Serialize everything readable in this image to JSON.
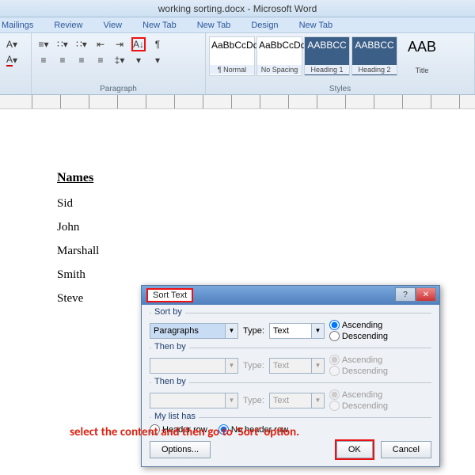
{
  "window": {
    "title": "working sorting.docx - Microsoft Word"
  },
  "tabs": [
    "Mailings",
    "Review",
    "View",
    "New Tab",
    "New Tab",
    "Design",
    "New Tab"
  ],
  "paragraph_group": "Paragraph",
  "styles_group": "Styles",
  "styles": [
    {
      "preview": "AaBbCcDdE",
      "name": "¶ Normal"
    },
    {
      "preview": "AaBbCcDdE",
      "name": "No Spacing"
    },
    {
      "preview": "AABBCC",
      "name": "Heading 1",
      "dark": true
    },
    {
      "preview": "AABBCC",
      "name": "Heading 2",
      "dark": true
    },
    {
      "preview": "AAB",
      "name": "Title"
    }
  ],
  "doc": {
    "header": "Names",
    "names": [
      "Sid",
      "John",
      "Marshall",
      "Smith",
      "Steve"
    ]
  },
  "dialog": {
    "title": "Sort Text",
    "sortby_label": "Sort by",
    "thenby_label": "Then by",
    "field1": "Paragraphs",
    "type_label": "Type:",
    "type_value": "Text",
    "asc": "Ascending",
    "desc": "Descending",
    "mylist_label": "My list has",
    "header_row": "Header row",
    "no_header_row": "No header row",
    "options": "Options...",
    "ok": "OK",
    "cancel": "Cancel"
  },
  "instruction": "select the content and then go to 'Sort' option."
}
